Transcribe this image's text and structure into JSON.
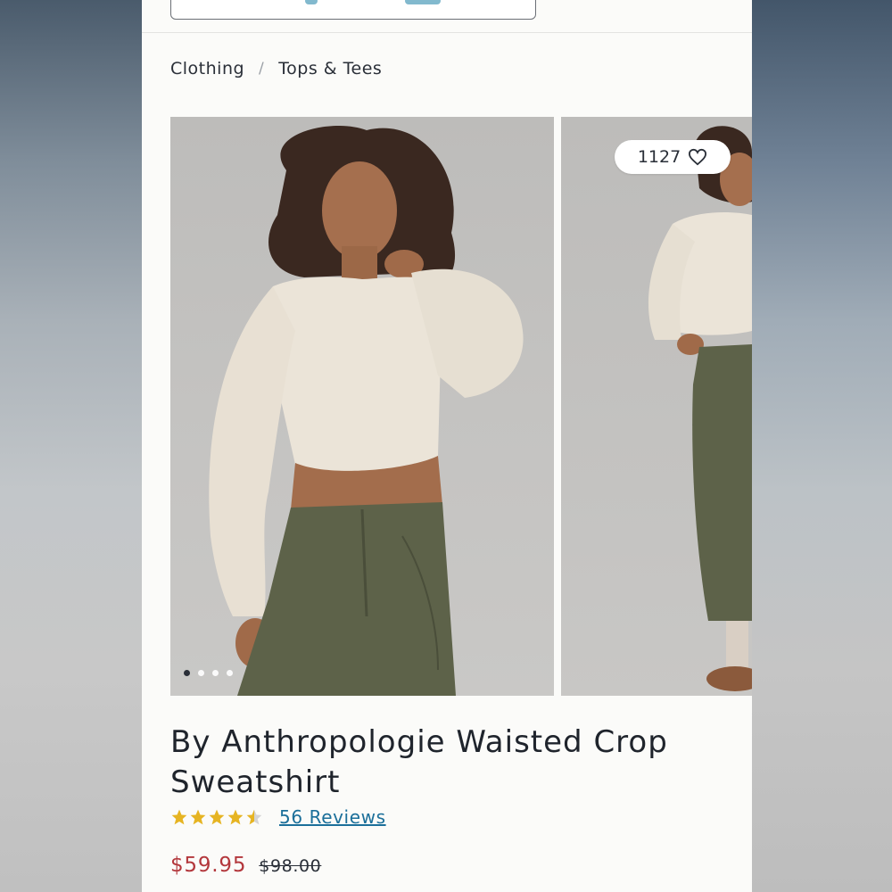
{
  "breadcrumb": [
    "Clothing",
    "Tops & Tees"
  ],
  "gallery": {
    "like_count": "1127",
    "image_count": 4,
    "active_image": 1
  },
  "product": {
    "title": "By Anthropologie Waisted Crop Sweatshirt",
    "rating": 4.5,
    "reviews_label": "56 Reviews",
    "sale_price": "$59.95",
    "original_price": "$98.00"
  },
  "colors": {
    "sale_price": "#b3373c",
    "link": "#1b6f9a",
    "star": "#e6b422"
  },
  "icons": [
    "heart-icon",
    "star-icon"
  ]
}
